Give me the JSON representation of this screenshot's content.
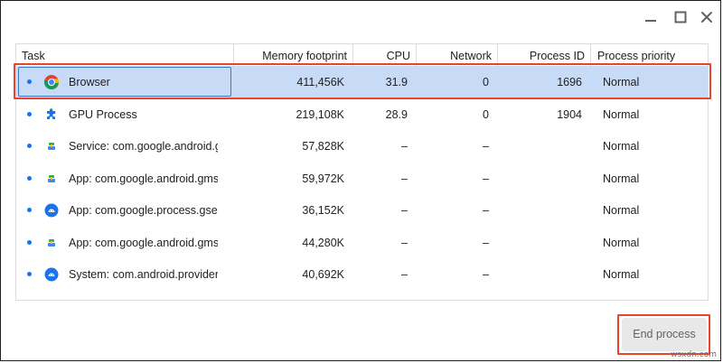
{
  "window_controls": [
    {
      "name": "minimize",
      "icon": "minimize-icon"
    },
    {
      "name": "maximize",
      "icon": "maximize-icon"
    },
    {
      "name": "close",
      "icon": "close-icon"
    }
  ],
  "columns": {
    "task": "Task",
    "memory": "Memory footprint",
    "cpu": "CPU",
    "network": "Network",
    "pid": "Process ID",
    "priority": "Process priority"
  },
  "rows": [
    {
      "icon": "chrome-icon",
      "task": "Browser",
      "memory": "411,456K",
      "cpu": "31.9",
      "network": "0",
      "pid": "1696",
      "priority": "Normal",
      "selected": true
    },
    {
      "icon": "puzzle-piece-icon",
      "task": "GPU Process",
      "memory": "219,108K",
      "cpu": "28.9",
      "network": "0",
      "pid": "1904",
      "priority": "Normal"
    },
    {
      "icon": "android-service-icon",
      "task": "Service: com.google.android.gms",
      "memory": "57,828K",
      "cpu": "–",
      "network": "–",
      "pid": "",
      "priority": "Normal"
    },
    {
      "icon": "android-service-icon",
      "task": "App: com.google.android.gms",
      "memory": "59,972K",
      "cpu": "–",
      "network": "–",
      "pid": "",
      "priority": "Normal"
    },
    {
      "icon": "android-app-icon",
      "task": "App: com.google.process.gservices",
      "memory": "36,152K",
      "cpu": "–",
      "network": "–",
      "pid": "",
      "priority": "Normal"
    },
    {
      "icon": "android-service-icon",
      "task": "App: com.google.android.gms.unstable",
      "memory": "44,280K",
      "cpu": "–",
      "network": "–",
      "pid": "",
      "priority": "Normal"
    },
    {
      "icon": "android-app-icon",
      "task": "System: com.android.providers.media",
      "memory": "40,692K",
      "cpu": "–",
      "network": "–",
      "pid": "",
      "priority": "Normal"
    }
  ],
  "actions": {
    "end_process": "End process"
  },
  "watermark": "wsxdn.com",
  "colors": {
    "selection": "#c8dbf6",
    "accent": "#1a73e8",
    "annotation": "#e8452c"
  }
}
